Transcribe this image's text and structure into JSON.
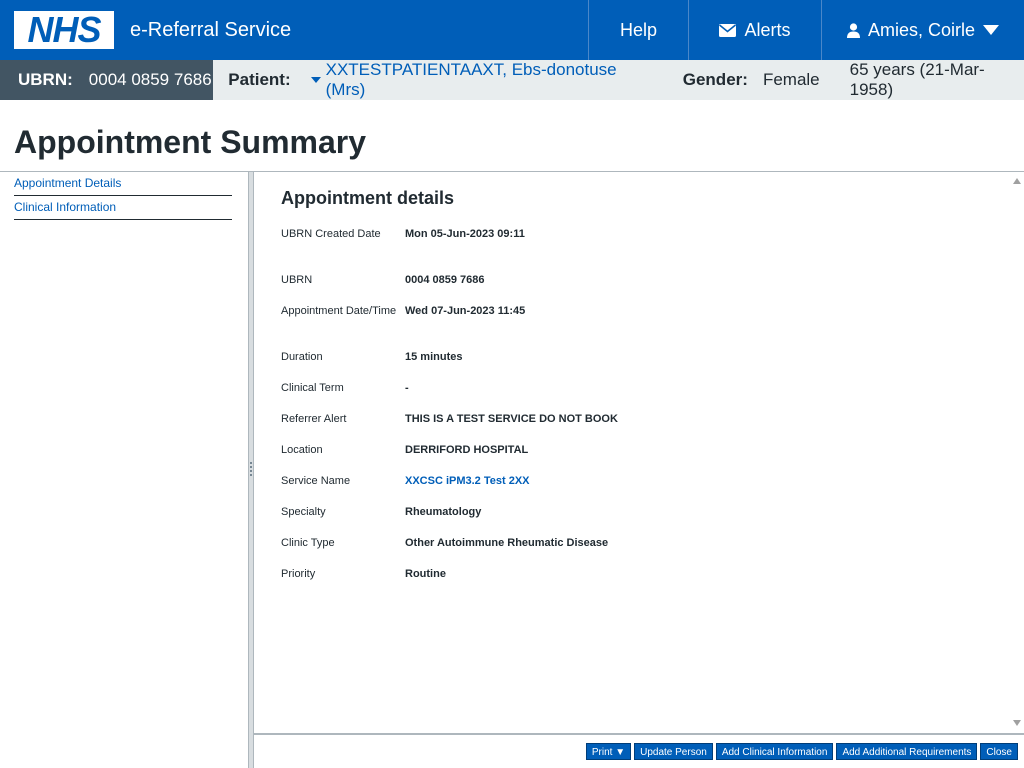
{
  "header": {
    "logo_text": "NHS",
    "service_name": "e-Referral Service",
    "nav": {
      "help": "Help",
      "alerts": "Alerts",
      "user": "Amies, Coirle"
    }
  },
  "banner": {
    "ubrn_label": "UBRN:",
    "ubrn_value": "0004 0859 7686",
    "patient_label": "Patient:",
    "patient_name": "XXTESTPATIENTAAXT, Ebs-donotuse (Mrs)",
    "gender_label": "Gender:",
    "gender_value": "Female",
    "age": "65 years (21-Mar-1958)"
  },
  "page_title": "Appointment Summary",
  "leftnav": {
    "items": [
      {
        "label": "Appointment Details"
      },
      {
        "label": "Clinical Information"
      }
    ]
  },
  "details": {
    "title": "Appointment details",
    "rows": [
      {
        "key": "UBRN Created Date",
        "value": "Mon 05-Jun-2023 09:11"
      },
      {
        "key": "UBRN",
        "value": "0004 0859 7686"
      },
      {
        "key": "Appointment Date/Time",
        "value": "Wed 07-Jun-2023 11:45"
      },
      {
        "key": "Duration",
        "value": "15 minutes"
      },
      {
        "key": "Clinical Term",
        "value": "-"
      },
      {
        "key": "Referrer Alert",
        "value": "THIS IS A TEST SERVICE DO NOT BOOK"
      },
      {
        "key": "Location",
        "value": "DERRIFORD HOSPITAL"
      },
      {
        "key": "Service Name",
        "value": "XXCSC iPM3.2 Test 2XX"
      },
      {
        "key": "Specialty",
        "value": "Rheumatology"
      },
      {
        "key": "Clinic Type",
        "value": "Other Autoimmune Rheumatic Disease"
      },
      {
        "key": "Priority",
        "value": "Routine"
      }
    ]
  },
  "actions": {
    "print": "Print ▼",
    "update_person": "Update Person",
    "add_clinical_information": "Add Clinical Information",
    "add_additional_requirements": "Add Additional Requirements",
    "close": "Close"
  },
  "colors": {
    "nhs_blue": "#005eb8",
    "banner_dark": "#425563",
    "banner_light": "#e8edee"
  }
}
